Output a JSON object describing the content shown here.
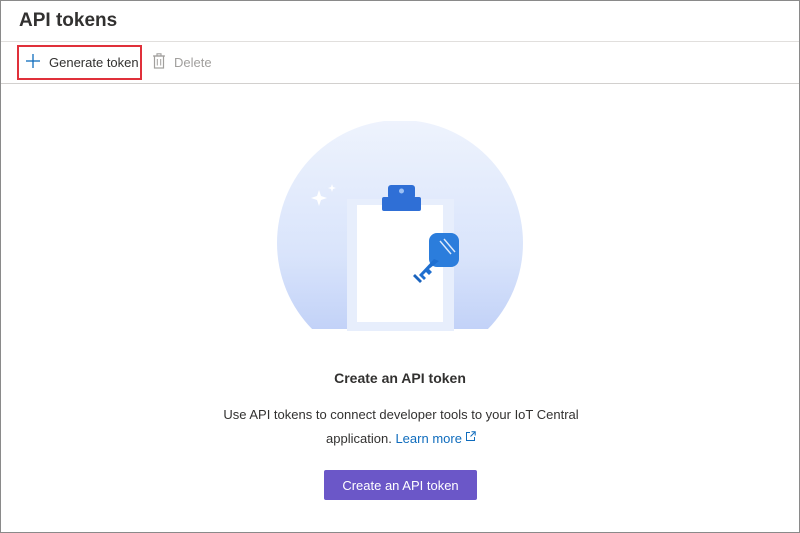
{
  "header": {
    "title": "API tokens"
  },
  "toolbar": {
    "generate_label": "Generate token",
    "generate_icon": "plus-icon",
    "delete_label": "Delete",
    "delete_icon": "trash-icon",
    "delete_disabled": true
  },
  "empty_state": {
    "illustration": "clipboard-key-illustration",
    "title": "Create an API token",
    "description_line1": "Use API tokens to connect developer tools to your IoT Central",
    "description_line2": "application.",
    "learn_more_label": "Learn more",
    "learn_more_icon": "external-link-icon",
    "create_button_label": "Create an API token"
  },
  "colors": {
    "accent": "#6b57c8",
    "link": "#0f6cbd",
    "highlight": "#e0303a",
    "icon_blue": "#1f73d8"
  }
}
